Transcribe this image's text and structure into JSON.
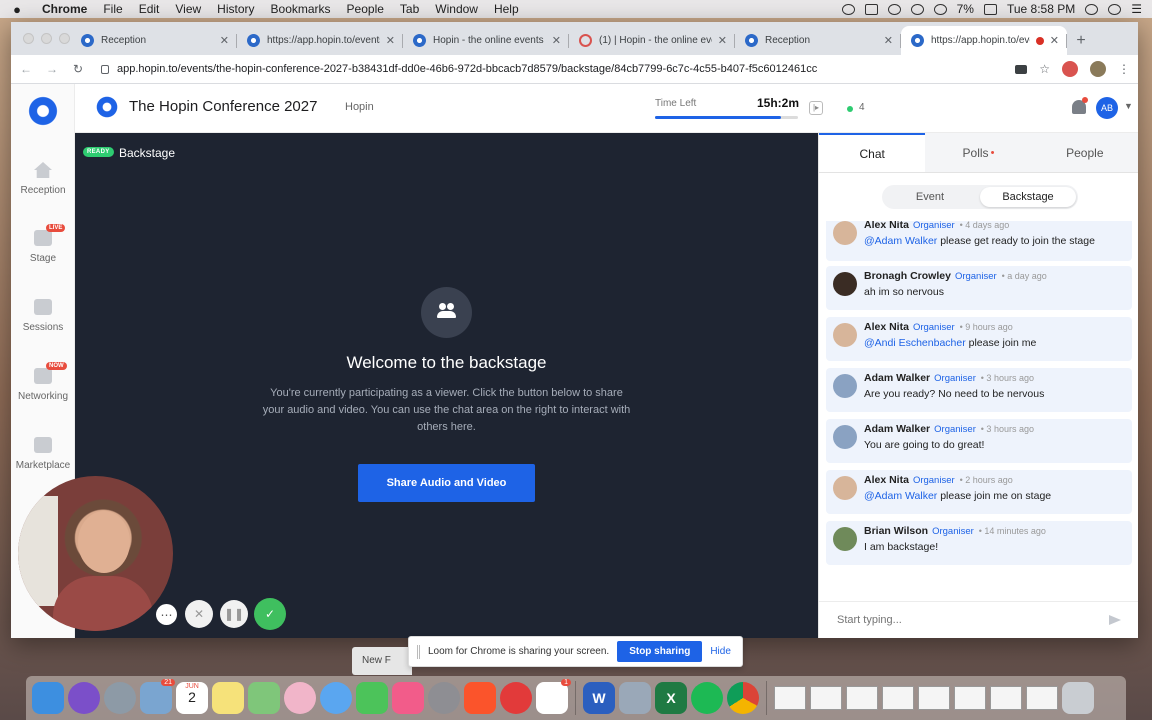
{
  "menubar": {
    "app": "Chrome",
    "items": [
      "File",
      "Edit",
      "View",
      "History",
      "Bookmarks",
      "People",
      "Tab",
      "Window",
      "Help"
    ],
    "battery": "7%",
    "clock": "Tue 8:58 PM"
  },
  "browser": {
    "tabs": [
      {
        "title": "Reception"
      },
      {
        "title": "https://app.hopin.to/events/"
      },
      {
        "title": "Hopin - the online events"
      },
      {
        "title": "(1) | Hopin - the online events"
      },
      {
        "title": "Reception"
      },
      {
        "title": "https://app.hopin.to/events/"
      }
    ],
    "url": "app.hopin.to/events/the-hopin-conference-2027-b38431df-dd0e-46b6-972d-bbcacb7d8579/backstage/84cb7799-6c7c-4c55-b407-f5c6012461cc"
  },
  "nav": {
    "items": [
      {
        "label": "Reception",
        "icon": "home-icon"
      },
      {
        "label": "Stage",
        "icon": "video-camera-icon",
        "tag": "LIVE"
      },
      {
        "label": "Sessions",
        "icon": "people-group-icon"
      },
      {
        "label": "Networking",
        "icon": "handshake-icon",
        "tag": "NOW"
      },
      {
        "label": "Marketplace",
        "icon": "store-icon"
      }
    ]
  },
  "header": {
    "event_title": "The Hopin Conference 2027",
    "organizer": "Hopin",
    "time_left_label": "Time Left",
    "time_left_value": "15h:2m",
    "time_left_progress": 0.88,
    "online_count": "4",
    "avatar_initials": "AB"
  },
  "stage": {
    "status_tag": "READY",
    "label": "Backstage",
    "welcome_title": "Welcome to the backstage",
    "description": "You're currently participating as a viewer. Click the button below to share your audio and video. You can use the chat area on the right to interact with others here.",
    "share_button": "Share Audio and Video"
  },
  "sidebar": {
    "tabs": [
      {
        "label": "Chat"
      },
      {
        "label": "Polls"
      },
      {
        "label": "People"
      }
    ],
    "segments": [
      "Event",
      "Backstage"
    ],
    "messages": [
      {
        "name": "Alex Nita",
        "role": "Organiser",
        "time": "• 4 days ago",
        "mention": "@Adam Walker",
        "text": " please get ready to join the stage"
      },
      {
        "name": "Bronagh Crowley",
        "role": "Organiser",
        "time": "• a day ago",
        "mention": "",
        "text": "ah im so nervous"
      },
      {
        "name": "Alex Nita",
        "role": "Organiser",
        "time": "• 9 hours ago",
        "mention": "@Andi Eschenbacher",
        "text": " please join me"
      },
      {
        "name": "Adam Walker",
        "role": "Organiser",
        "time": "• 3 hours ago",
        "mention": "",
        "text": "Are you ready? No need to be nervous"
      },
      {
        "name": "Adam Walker",
        "role": "Organiser",
        "time": "• 3 hours ago",
        "mention": "",
        "text": "You are going to do great!"
      },
      {
        "name": "Alex Nita",
        "role": "Organiser",
        "time": "• 2 hours ago",
        "mention": "@Adam Walker",
        "text": " please join me on stage"
      },
      {
        "name": "Brian Wilson",
        "role": "Organiser",
        "time": "• 14 minutes ago",
        "mention": "",
        "text": "I am backstage!"
      }
    ],
    "composer_placeholder": "Start typing..."
  },
  "loom": {
    "text": "Loom for Chrome is sharing your screen.",
    "stop": "Stop sharing",
    "hide": "Hide",
    "behind_text": "New F"
  },
  "dock": {
    "calendar_month": "JUN",
    "calendar_day": "2",
    "mail_badge": "21",
    "slack_badge": "1",
    "word_letter": "W",
    "excel_letter": "X"
  },
  "colors": {
    "accent": "#1e63e6",
    "stage_bg": "#1e2431",
    "ready": "#2ecc71",
    "live": "#e84c3d"
  }
}
